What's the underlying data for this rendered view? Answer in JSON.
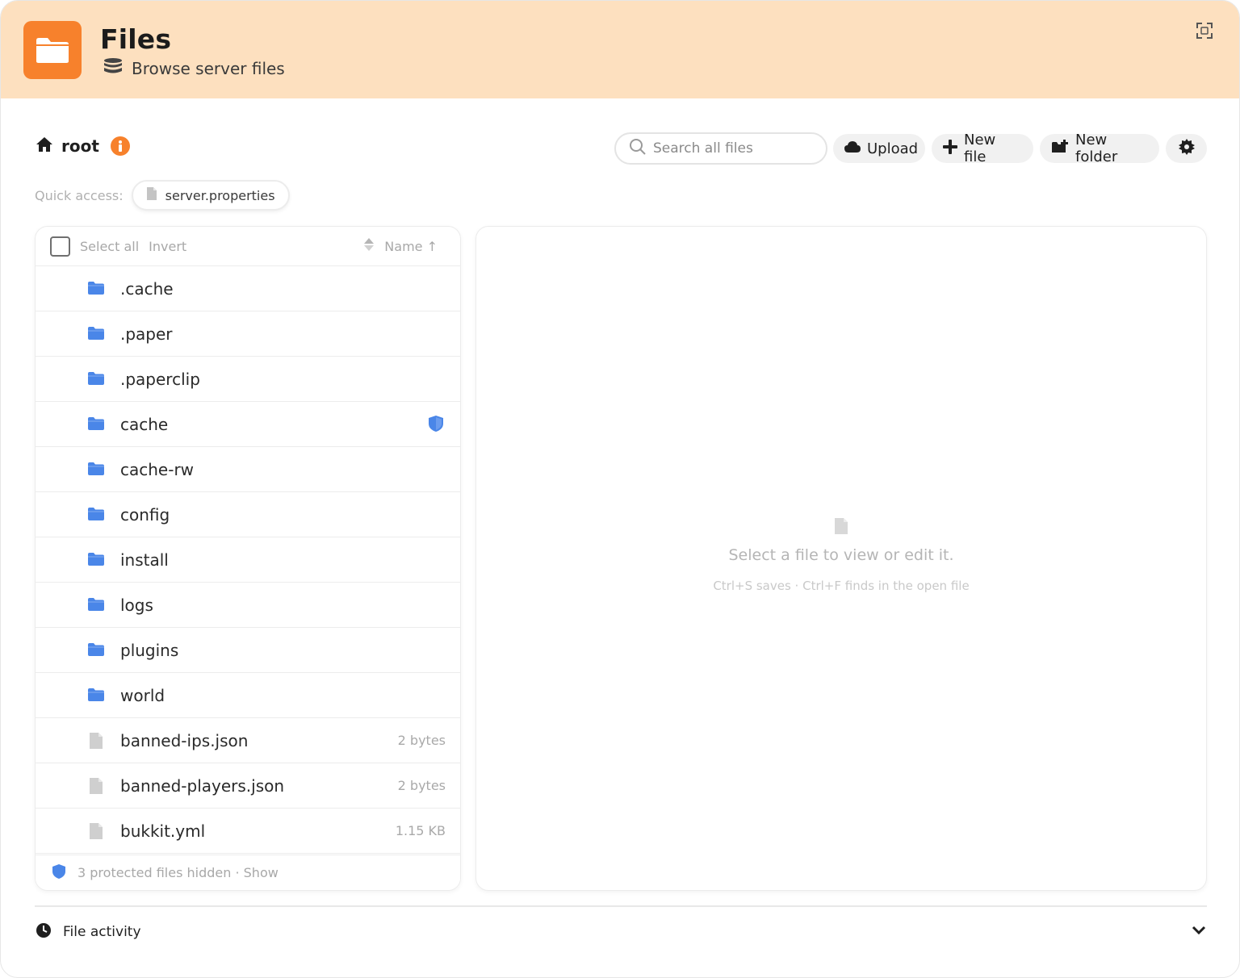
{
  "header": {
    "title": "Files",
    "subtitle": "Browse server files",
    "brand_color": "#f7812c",
    "background": "#fde0bf"
  },
  "toolbar": {
    "breadcrumb": "root",
    "search_placeholder": "Search all files",
    "upload_label": "Upload",
    "new_file_label": "New file",
    "new_folder_label": "New folder"
  },
  "quick_access": {
    "label": "Quick access:",
    "items": [
      "server.properties"
    ]
  },
  "list": {
    "select_all": "Select all",
    "invert": "Invert",
    "sort_label": "Name ↑",
    "rows": [
      {
        "name": ".cache",
        "type": "folder",
        "icon": "folder-icon"
      },
      {
        "name": ".paper",
        "type": "folder",
        "icon": "folder-icon"
      },
      {
        "name": ".paperclip",
        "type": "folder",
        "icon": "folder-icon"
      },
      {
        "name": "cache",
        "type": "folder",
        "icon": "folder-icon",
        "protected": true
      },
      {
        "name": "cache-rw",
        "type": "folder",
        "icon": "folder-icon"
      },
      {
        "name": "config",
        "type": "folder",
        "icon": "folder-icon"
      },
      {
        "name": "install",
        "type": "folder",
        "icon": "folder-icon"
      },
      {
        "name": "logs",
        "type": "folder",
        "icon": "folder-icon"
      },
      {
        "name": "plugins",
        "type": "folder",
        "icon": "folder-icon"
      },
      {
        "name": "world",
        "type": "folder",
        "icon": "folder-icon"
      },
      {
        "name": "banned-ips.json",
        "type": "file",
        "icon": "file-icon",
        "size": "2 bytes"
      },
      {
        "name": "banned-players.json",
        "type": "file",
        "icon": "file-icon",
        "size": "2 bytes"
      },
      {
        "name": "bukkit.yml",
        "type": "file",
        "icon": "file-icon",
        "size": "1.15 KB"
      }
    ],
    "footer": "3 protected files hidden · Show"
  },
  "viewer": {
    "message": "Select a file to view or edit it.",
    "hint": "Ctrl+S saves · Ctrl+F finds in the open file"
  },
  "activity": {
    "label": "File activity"
  }
}
